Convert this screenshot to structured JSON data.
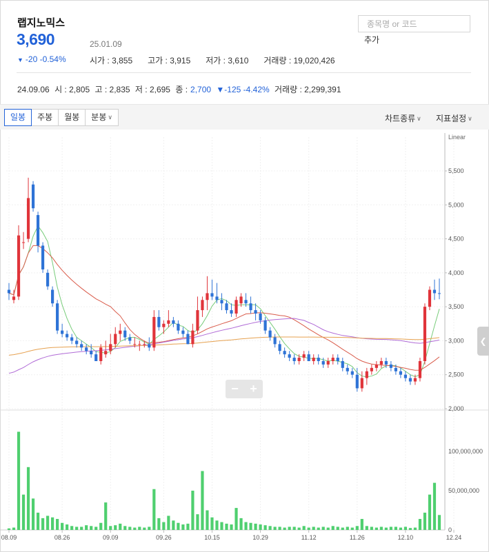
{
  "stock": {
    "name": "랩지노믹스",
    "price": "3,690",
    "date": "25.01.09",
    "change": "-20 -0.54%",
    "change_glyph": "▼",
    "open": "시가 : 3,855",
    "high": "고가 : 3,915",
    "low": "저가 : 3,610",
    "volume": "거래량 : 19,020,426"
  },
  "search": {
    "placeholder": "종목명 or 코드",
    "add_label": "추가"
  },
  "history": {
    "date": "24.09.06",
    "open": "시 : 2,805",
    "high": "고 : 2,835",
    "low": "저 : 2,695",
    "close_label": "종 :",
    "close_value": "2,700",
    "change": "▼-125 -4.42%",
    "volume": "거래량 : 2,299,391"
  },
  "toolbar": {
    "tabs": [
      "일봉",
      "주봉",
      "월봉",
      "분봉"
    ],
    "active_tab": "일봉",
    "chart_type_label": "차트종류",
    "indicator_label": "지표설정"
  },
  "colors": {
    "up": "#e0343a",
    "down": "#2e73d6",
    "volume": "#4fcf6f",
    "ma5": "#78cc7a",
    "ma20": "#d95b4a",
    "ma60": "#b06ad6",
    "ma120": "#e6a04e",
    "accent": "#2262d8"
  },
  "chart_data": {
    "type": "candlestick",
    "price_axis": {
      "label": "Linear",
      "min": 2000,
      "max": 5500,
      "ticks": [
        "5,500",
        "5,000",
        "4,500",
        "4,000",
        "3,500",
        "3,000",
        "2,500",
        "2,000"
      ]
    },
    "volume_axis": {
      "min": 0,
      "max": 150000000,
      "ticks": [
        "100,000,000",
        "50,000,000",
        "0"
      ]
    },
    "x_ticks": [
      "08.09",
      "08.26",
      "09.09",
      "09.26",
      "10.15",
      "10.29",
      "11.12",
      "11.26",
      "12.10",
      "12.24"
    ],
    "x_tick_index": [
      0,
      11,
      21,
      32,
      42,
      52,
      62,
      72,
      82,
      92
    ],
    "candles": [
      [
        3750,
        3850,
        3600,
        3700,
        2000000
      ],
      [
        3600,
        3750,
        3550,
        3650,
        3000000
      ],
      [
        3650,
        4700,
        3600,
        4550,
        125000000
      ],
      [
        4450,
        4600,
        4350,
        4450,
        45000000
      ],
      [
        4500,
        5400,
        4450,
        5100,
        80000000
      ],
      [
        5300,
        5350,
        4900,
        4950,
        40000000
      ],
      [
        4850,
        4900,
        4300,
        4400,
        22000000
      ],
      [
        4400,
        4450,
        4000,
        4050,
        15000000
      ],
      [
        4000,
        4050,
        3750,
        3800,
        18000000
      ],
      [
        3750,
        3800,
        3500,
        3550,
        16000000
      ],
      [
        3550,
        3600,
        3100,
        3150,
        14000000
      ],
      [
        3150,
        3250,
        3050,
        3100,
        9000000
      ],
      [
        3100,
        3150,
        3000,
        3050,
        7000000
      ],
      [
        3050,
        3100,
        2950,
        3000,
        5000000
      ],
      [
        3000,
        3050,
        2900,
        2950,
        4000000
      ],
      [
        2950,
        3000,
        2850,
        2900,
        4000000
      ],
      [
        2900,
        2950,
        2800,
        2850,
        6000000
      ],
      [
        2850,
        2950,
        2750,
        2800,
        5000000
      ],
      [
        2800,
        2850,
        2700,
        2700,
        4000000
      ],
      [
        2700,
        2950,
        2650,
        2900,
        9000000
      ],
      [
        2800,
        3000,
        2750,
        2850,
        35000000
      ],
      [
        2850,
        3100,
        2800,
        2950,
        5000000
      ],
      [
        2950,
        3200,
        2900,
        3100,
        6000000
      ],
      [
        3100,
        3250,
        3000,
        3150,
        8000000
      ],
      [
        3150,
        3200,
        3000,
        3050,
        5000000
      ],
      [
        3050,
        3100,
        2950,
        3000,
        4000000
      ],
      [
        2950,
        3050,
        2900,
        2950,
        3000000
      ],
      [
        2950,
        3000,
        2850,
        2950,
        4000000
      ],
      [
        2950,
        3000,
        2900,
        2950,
        3000000
      ],
      [
        2950,
        3050,
        2850,
        2900,
        4000000
      ],
      [
        2900,
        3450,
        2850,
        3350,
        52000000
      ],
      [
        3350,
        3450,
        3150,
        3200,
        15000000
      ],
      [
        3200,
        3300,
        3100,
        3250,
        10000000
      ],
      [
        3250,
        3450,
        3200,
        3300,
        18000000
      ],
      [
        3300,
        3350,
        3200,
        3250,
        12000000
      ],
      [
        3250,
        3300,
        3100,
        3150,
        9000000
      ],
      [
        3150,
        3200,
        3050,
        3100,
        7000000
      ],
      [
        3100,
        3150,
        2950,
        2950,
        8000000
      ],
      [
        2950,
        3250,
        2900,
        3150,
        50000000
      ],
      [
        3150,
        3650,
        3100,
        3450,
        20000000
      ],
      [
        3450,
        3650,
        3350,
        3600,
        75000000
      ],
      [
        3600,
        3950,
        3450,
        3700,
        25000000
      ],
      [
        3700,
        3900,
        3600,
        3650,
        16000000
      ],
      [
        3650,
        3850,
        3550,
        3600,
        12000000
      ],
      [
        3600,
        3700,
        3450,
        3550,
        10000000
      ],
      [
        3550,
        3600,
        3400,
        3450,
        8000000
      ],
      [
        3450,
        3550,
        3350,
        3400,
        7000000
      ],
      [
        3400,
        3650,
        3350,
        3600,
        28000000
      ],
      [
        3550,
        3700,
        3500,
        3650,
        15000000
      ],
      [
        3600,
        3700,
        3500,
        3550,
        10000000
      ],
      [
        3550,
        3650,
        3400,
        3450,
        9000000
      ],
      [
        3450,
        3550,
        3300,
        3400,
        8000000
      ],
      [
        3400,
        3450,
        3250,
        3300,
        7000000
      ],
      [
        3300,
        3350,
        3100,
        3150,
        6000000
      ],
      [
        3150,
        3200,
        3000,
        3050,
        5000000
      ],
      [
        3050,
        3100,
        2900,
        2950,
        4000000
      ],
      [
        2950,
        3000,
        2800,
        2850,
        4000000
      ],
      [
        2850,
        2900,
        2750,
        2800,
        3000000
      ],
      [
        2800,
        2850,
        2700,
        2750,
        4000000
      ],
      [
        2750,
        2800,
        2650,
        2700,
        4000000
      ],
      [
        2700,
        2800,
        2650,
        2750,
        3000000
      ],
      [
        2750,
        2850,
        2700,
        2800,
        5000000
      ],
      [
        2800,
        2850,
        2700,
        2700,
        3000000
      ],
      [
        2700,
        2800,
        2650,
        2750,
        4000000
      ],
      [
        2750,
        2800,
        2650,
        2700,
        3000000
      ],
      [
        2700,
        2750,
        2600,
        2650,
        4000000
      ],
      [
        2650,
        2750,
        2600,
        2700,
        3000000
      ],
      [
        2700,
        2800,
        2650,
        2750,
        5000000
      ],
      [
        2750,
        2800,
        2650,
        2700,
        4000000
      ],
      [
        2700,
        2750,
        2550,
        2600,
        3000000
      ],
      [
        2600,
        2650,
        2500,
        2550,
        4000000
      ],
      [
        2550,
        2600,
        2450,
        2500,
        3000000
      ],
      [
        2500,
        2600,
        2250,
        2300,
        5000000
      ],
      [
        2300,
        2550,
        2250,
        2450,
        14000000
      ],
      [
        2450,
        2600,
        2350,
        2550,
        5000000
      ],
      [
        2550,
        2650,
        2500,
        2600,
        4000000
      ],
      [
        2600,
        2700,
        2550,
        2650,
        3000000
      ],
      [
        2650,
        2750,
        2600,
        2700,
        4000000
      ],
      [
        2700,
        2750,
        2600,
        2650,
        3000000
      ],
      [
        2650,
        2700,
        2550,
        2600,
        4000000
      ],
      [
        2600,
        2650,
        2500,
        2550,
        4000000
      ],
      [
        2550,
        2600,
        2450,
        2500,
        3000000
      ],
      [
        2500,
        2550,
        2400,
        2450,
        4000000
      ],
      [
        2450,
        2500,
        2350,
        2400,
        2500000
      ],
      [
        2400,
        2500,
        2350,
        2450,
        3000000
      ],
      [
        2450,
        2750,
        2400,
        2700,
        14000000
      ],
      [
        2700,
        3550,
        2650,
        3500,
        22000000
      ],
      [
        3500,
        3800,
        3450,
        3750,
        45000000
      ],
      [
        3750,
        3900,
        3600,
        3700,
        60000000
      ],
      [
        3700,
        3915,
        3610,
        3690,
        19020426
      ]
    ]
  }
}
